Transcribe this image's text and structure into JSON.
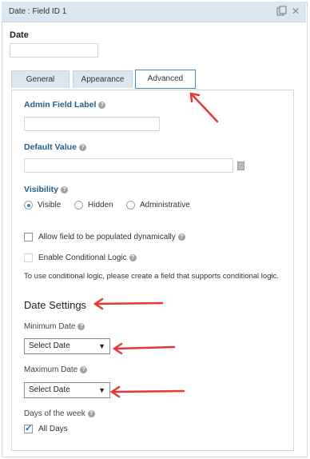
{
  "window": {
    "title": "Date : Field ID 1"
  },
  "field": {
    "label": "Date"
  },
  "tabs": [
    {
      "label": "General"
    },
    {
      "label": "Appearance"
    },
    {
      "label": "Advanced"
    }
  ],
  "advanced": {
    "admin_label": "Admin Field Label",
    "default_value": "Default Value",
    "visibility": "Visibility",
    "visibility_options": [
      "Visible",
      "Hidden",
      "Administrative"
    ],
    "selected_visibility": "Visible",
    "allow_dynamic": "Allow field to be populated dynamically",
    "conditional_logic": "Enable Conditional Logic",
    "conditional_note": "To use conditional logic, please create a field that supports conditional logic."
  },
  "date_settings": {
    "heading": "Date Settings",
    "min_label": "Minimum Date",
    "min_value": "Select Date",
    "max_label": "Maximum Date",
    "max_value": "Select Date",
    "days_label": "Days of the week",
    "all_days": "All Days"
  },
  "colors": {
    "accent": "#3a8ccf",
    "annotation": "#e53935",
    "titlebar": "#dbe6f0"
  }
}
